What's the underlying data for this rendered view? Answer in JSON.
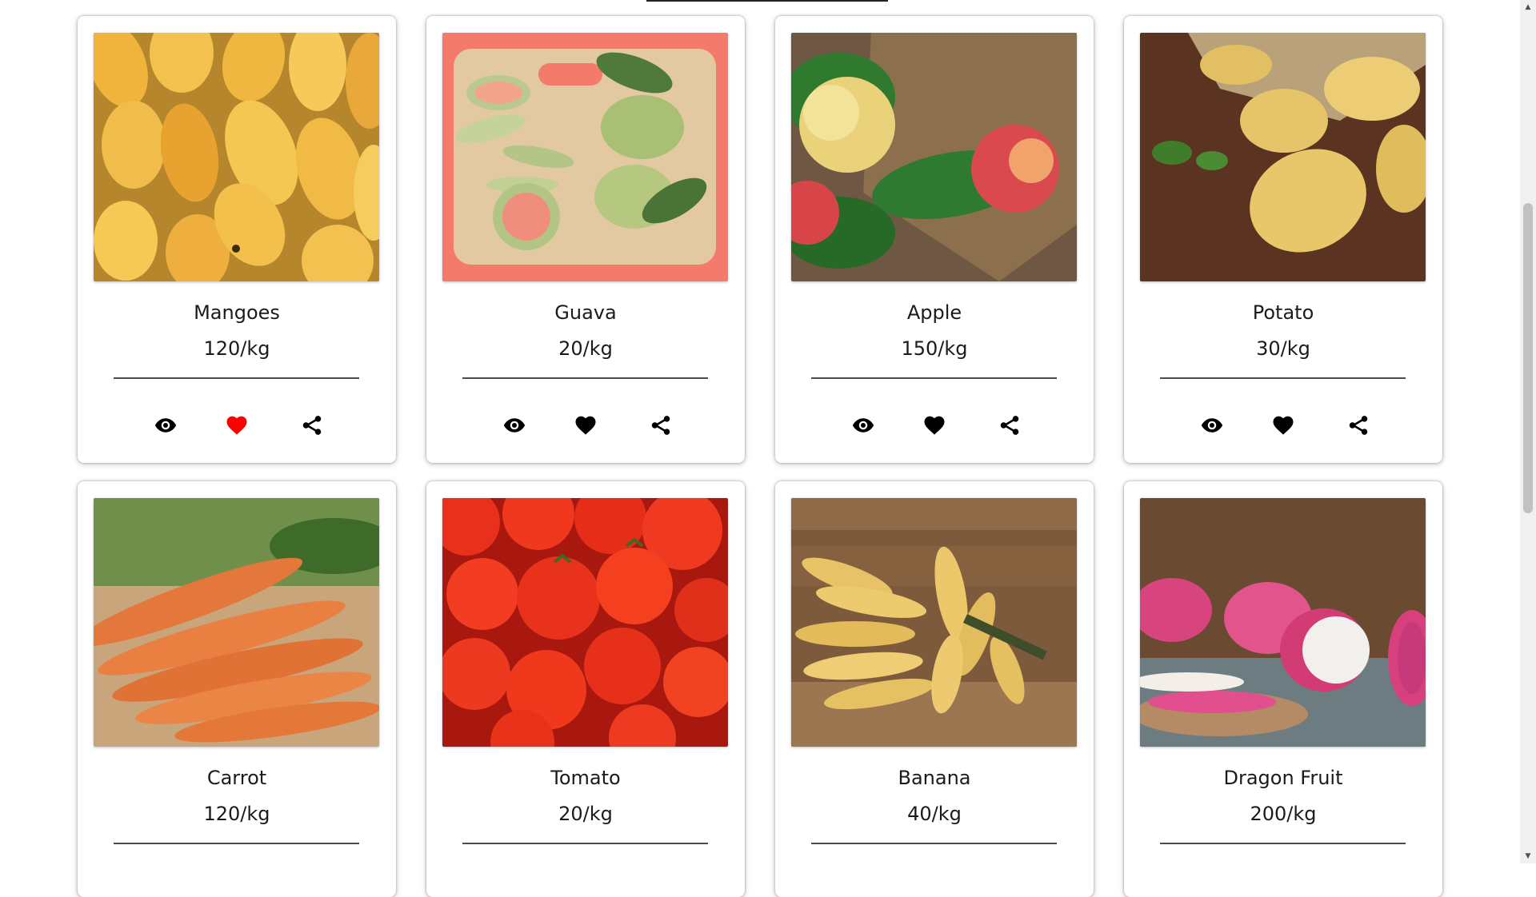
{
  "products": [
    {
      "name": "Mangoes",
      "price": "120/kg",
      "liked": true
    },
    {
      "name": "Guava",
      "price": "20/kg",
      "liked": false
    },
    {
      "name": "Apple",
      "price": "150/kg",
      "liked": false
    },
    {
      "name": "Potato",
      "price": "30/kg",
      "liked": false
    },
    {
      "name": "Carrot",
      "price": "120/kg",
      "liked": false
    },
    {
      "name": "Tomato",
      "price": "20/kg",
      "liked": false
    },
    {
      "name": "Banana",
      "price": "40/kg",
      "liked": false
    },
    {
      "name": "Dragon Fruit",
      "price": "200/kg",
      "liked": false
    }
  ],
  "icons": {
    "view": "eye-icon",
    "like": "heart-icon",
    "share": "share-icon"
  },
  "colors": {
    "liked": "#ff0000",
    "icon": "#000000",
    "card_bg": "#ffffff"
  },
  "scrollbar": {
    "up": "▲",
    "down": "▼"
  }
}
